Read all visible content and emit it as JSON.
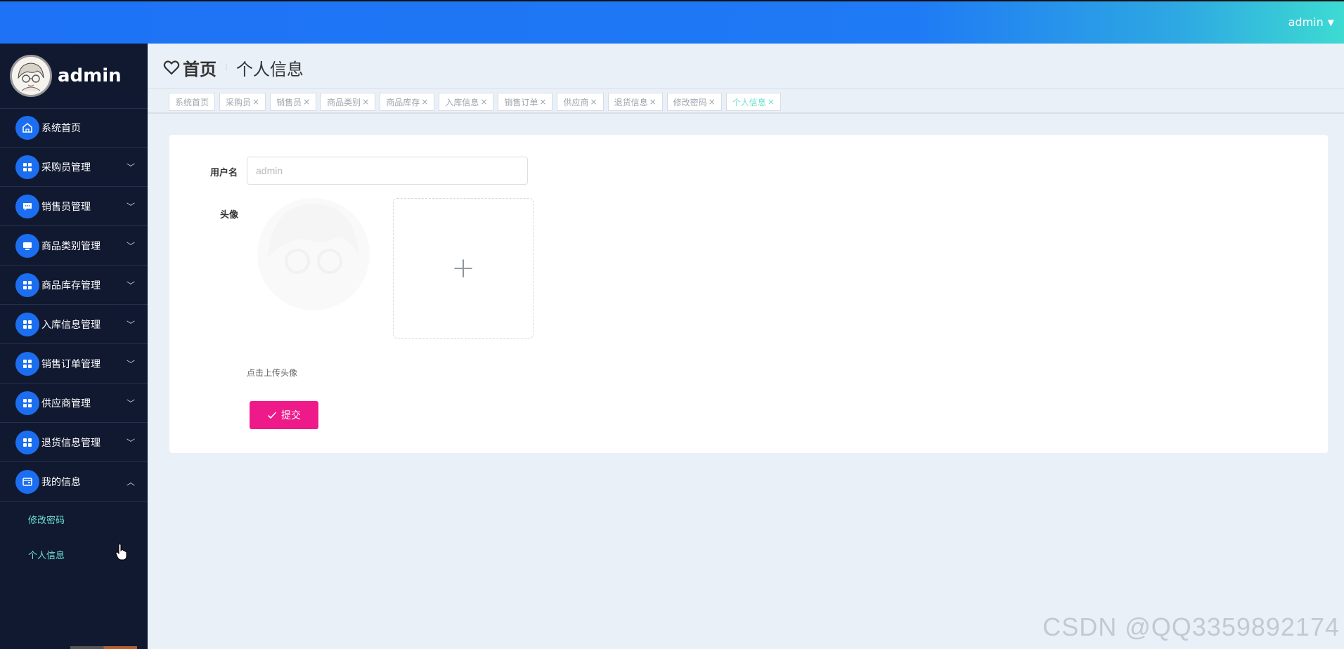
{
  "topbar": {
    "username": "admin"
  },
  "sidebar": {
    "username": "admin",
    "items": [
      {
        "label": "系统首页",
        "icon": "home-icon",
        "has_children": false
      },
      {
        "label": "采购员管理",
        "icon": "grid-icon",
        "has_children": true
      },
      {
        "label": "销售员管理",
        "icon": "chat-icon",
        "has_children": true
      },
      {
        "label": "商品类别管理",
        "icon": "monitor-icon",
        "has_children": true
      },
      {
        "label": "商品库存管理",
        "icon": "grid-icon",
        "has_children": true
      },
      {
        "label": "入库信息管理",
        "icon": "grid-icon",
        "has_children": true
      },
      {
        "label": "销售订单管理",
        "icon": "grid-icon",
        "has_children": true
      },
      {
        "label": "供应商管理",
        "icon": "grid-icon",
        "has_children": true
      },
      {
        "label": "退货信息管理",
        "icon": "grid-icon",
        "has_children": true
      },
      {
        "label": "我的信息",
        "icon": "wallet-icon",
        "has_children": true,
        "expanded": true
      }
    ],
    "subitems": [
      {
        "label": "修改密码"
      },
      {
        "label": "个人信息"
      }
    ]
  },
  "breadcrumb": {
    "home": "首页",
    "current": "个人信息"
  },
  "tags": [
    {
      "label": "系统首页",
      "closable": false,
      "active": false
    },
    {
      "label": "采购员",
      "closable": true,
      "active": false
    },
    {
      "label": "销售员",
      "closable": true,
      "active": false
    },
    {
      "label": "商品类别",
      "closable": true,
      "active": false
    },
    {
      "label": "商品库存",
      "closable": true,
      "active": false
    },
    {
      "label": "入库信息",
      "closable": true,
      "active": false
    },
    {
      "label": "销售订单",
      "closable": true,
      "active": false
    },
    {
      "label": "供应商",
      "closable": true,
      "active": false
    },
    {
      "label": "退货信息",
      "closable": true,
      "active": false
    },
    {
      "label": "修改密码",
      "closable": true,
      "active": false
    },
    {
      "label": "个人信息",
      "closable": true,
      "active": true
    }
  ],
  "form": {
    "username_label": "用户名",
    "username_placeholder": "admin",
    "username_value": "",
    "avatar_label": "头像",
    "upload_tip": "点击上传头像",
    "submit_label": "提交"
  },
  "watermark": "CSDN @QQ3359892174",
  "colors": {
    "topbar_start": "#1d72f5",
    "topbar_end": "#3ddbd2",
    "sidebar_bg": "#111931",
    "menu_icon_bg": "#1c6ef0",
    "active_text": "#6fe0cf",
    "submit_bg": "#ee1a8a"
  }
}
